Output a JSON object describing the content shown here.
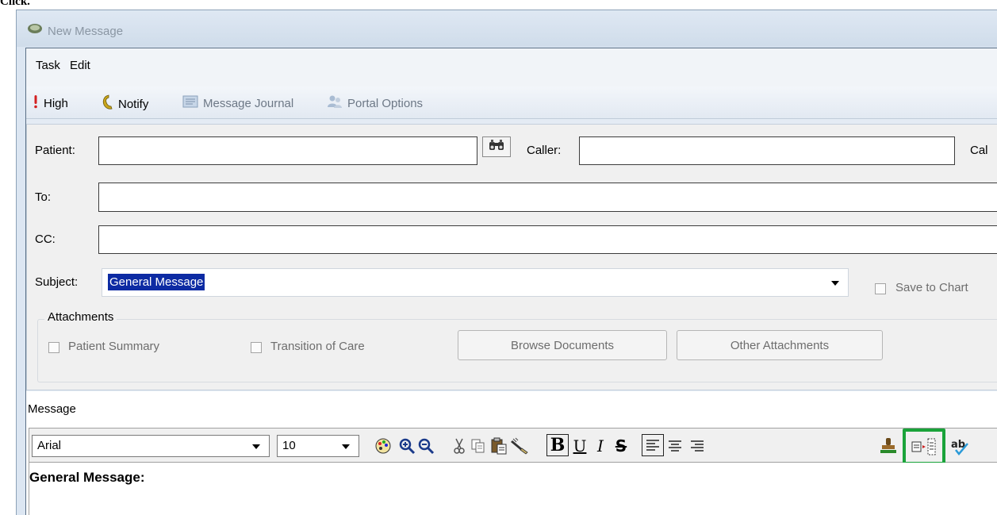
{
  "top_text": "Click.",
  "window": {
    "title": "New Message"
  },
  "menu": {
    "items": [
      "Task",
      "Edit"
    ]
  },
  "toolbar": {
    "high": "High",
    "notify": "Notify",
    "message_journal": "Message Journal",
    "portal_options": "Portal Options"
  },
  "form": {
    "patient_label": "Patient:",
    "patient_value": "",
    "caller_label": "Caller:",
    "caller_value": "",
    "cal_label": "Cal",
    "to_label": "To:",
    "to_value": "",
    "cc_label": "CC:",
    "cc_value": "",
    "subject_label": "Subject:",
    "subject_value": "General Message",
    "save_to_chart": "Save to Chart"
  },
  "attachments": {
    "title": "Attachments",
    "patient_summary": "Patient Summary",
    "transition_of_care": "Transition of Care",
    "browse_documents": "Browse Documents",
    "other_attachments": "Other Attachments"
  },
  "message": {
    "label": "Message",
    "font": "Arial",
    "size": "10",
    "body_heading": "General Message:"
  },
  "colors": {
    "highlight": "#1aa33a",
    "selection": "#0d2ba3"
  }
}
